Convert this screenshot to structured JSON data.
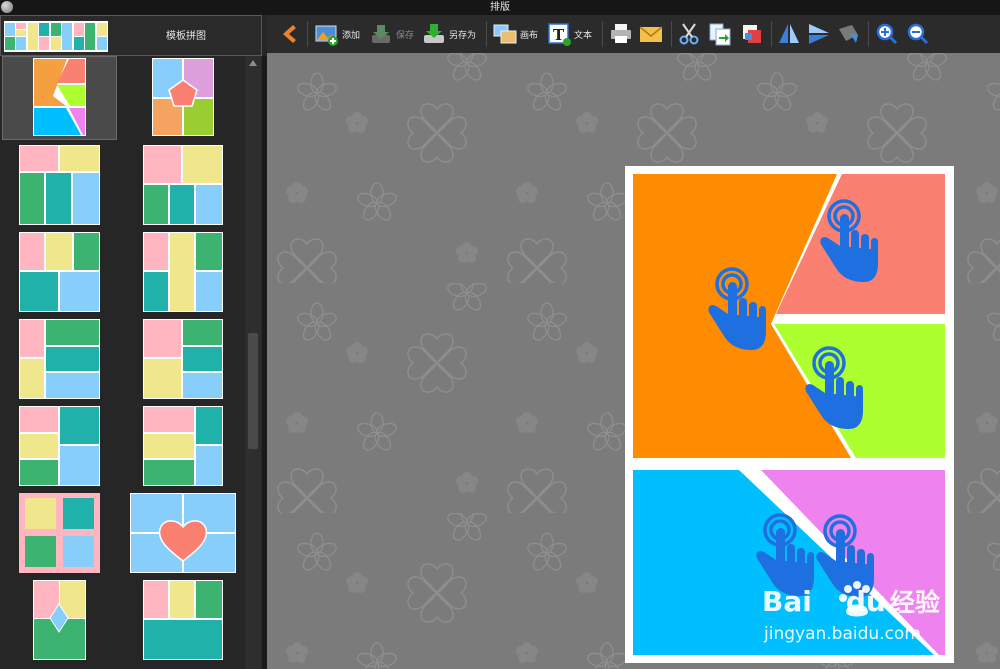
{
  "window": {
    "title": "排版"
  },
  "toolbar": {
    "back_label": "",
    "add_label": "添加",
    "save_label": "保存",
    "save_as_label": "另存为",
    "canvas_label": "画布",
    "text_label": "文本"
  },
  "sidebar": {
    "header_label": "模板拼图"
  },
  "colors": {
    "orange": "#ff8c00",
    "salmon": "#fa8072",
    "lime": "#adff2f",
    "sky": "#00bfff",
    "violet": "#ee82ee",
    "hand": "#1e6fe0",
    "tpl_pink": "#ffb6c1",
    "tpl_yellow": "#f0e68c",
    "tpl_green": "#3cb371",
    "tpl_teal": "#20b2aa",
    "tpl_blue": "#87cefa"
  },
  "watermark": {
    "brand_a": "Bai",
    "brand_b": "du",
    "brand_cn": "经验",
    "url": "jingyan.baidu.com"
  }
}
